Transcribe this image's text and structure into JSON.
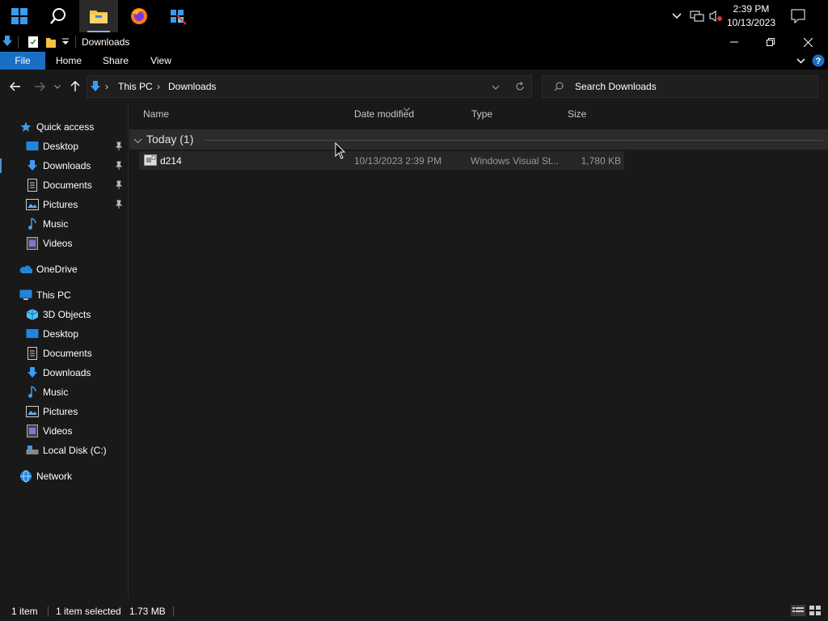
{
  "taskbar": {
    "clock": {
      "time": "2:39 PM",
      "date": "10/13/2023"
    },
    "icons": [
      "windows-start-icon",
      "search-icon",
      "file-explorer-icon",
      "firefox-icon",
      "snipping-tool-icon"
    ],
    "tray": [
      "chevron-up-icon",
      "network-icon",
      "volume-muted-icon",
      "notification-icon"
    ]
  },
  "window": {
    "title": "Downloads",
    "controls": [
      "minimize",
      "restore",
      "close"
    ]
  },
  "ribbon": {
    "tabs": [
      "File",
      "Home",
      "Share",
      "View"
    ]
  },
  "address": {
    "crumbs": [
      "This PC",
      "Downloads"
    ],
    "search_placeholder": "Search Downloads"
  },
  "navigation": {
    "quick_access": "Quick access",
    "quick_items": [
      {
        "label": "Desktop",
        "icon": "desktop-icon",
        "pinned": true
      },
      {
        "label": "Downloads",
        "icon": "downloads-icon",
        "pinned": true
      },
      {
        "label": "Documents",
        "icon": "documents-icon",
        "pinned": true
      },
      {
        "label": "Pictures",
        "icon": "pictures-icon",
        "pinned": true
      },
      {
        "label": "Music",
        "icon": "music-icon",
        "pinned": false
      },
      {
        "label": "Videos",
        "icon": "videos-icon",
        "pinned": false
      }
    ],
    "onedrive": "OneDrive",
    "this_pc": "This PC",
    "pc_items": [
      {
        "label": "3D Objects",
        "icon": "3d-objects-icon"
      },
      {
        "label": "Desktop",
        "icon": "desktop-icon"
      },
      {
        "label": "Documents",
        "icon": "documents-icon"
      },
      {
        "label": "Downloads",
        "icon": "downloads-icon"
      },
      {
        "label": "Music",
        "icon": "music-icon"
      },
      {
        "label": "Pictures",
        "icon": "pictures-icon"
      },
      {
        "label": "Videos",
        "icon": "videos-icon"
      },
      {
        "label": "Local Disk (C:)",
        "icon": "local-disk-icon"
      }
    ],
    "network": "Network"
  },
  "columns": [
    "Name",
    "Date modified",
    "Type",
    "Size"
  ],
  "group": {
    "label": "Today (1)"
  },
  "files": [
    {
      "name": "d214",
      "date": "10/13/2023 2:39 PM",
      "type": "Windows Visual St...",
      "size": "1,780 KB"
    }
  ],
  "status": {
    "count": "1 item",
    "selected": "1 item selected",
    "size": "1.73 MB"
  },
  "colors": {
    "accent": "#1a6fc4",
    "background": "#191919",
    "chrome": "#000000"
  }
}
